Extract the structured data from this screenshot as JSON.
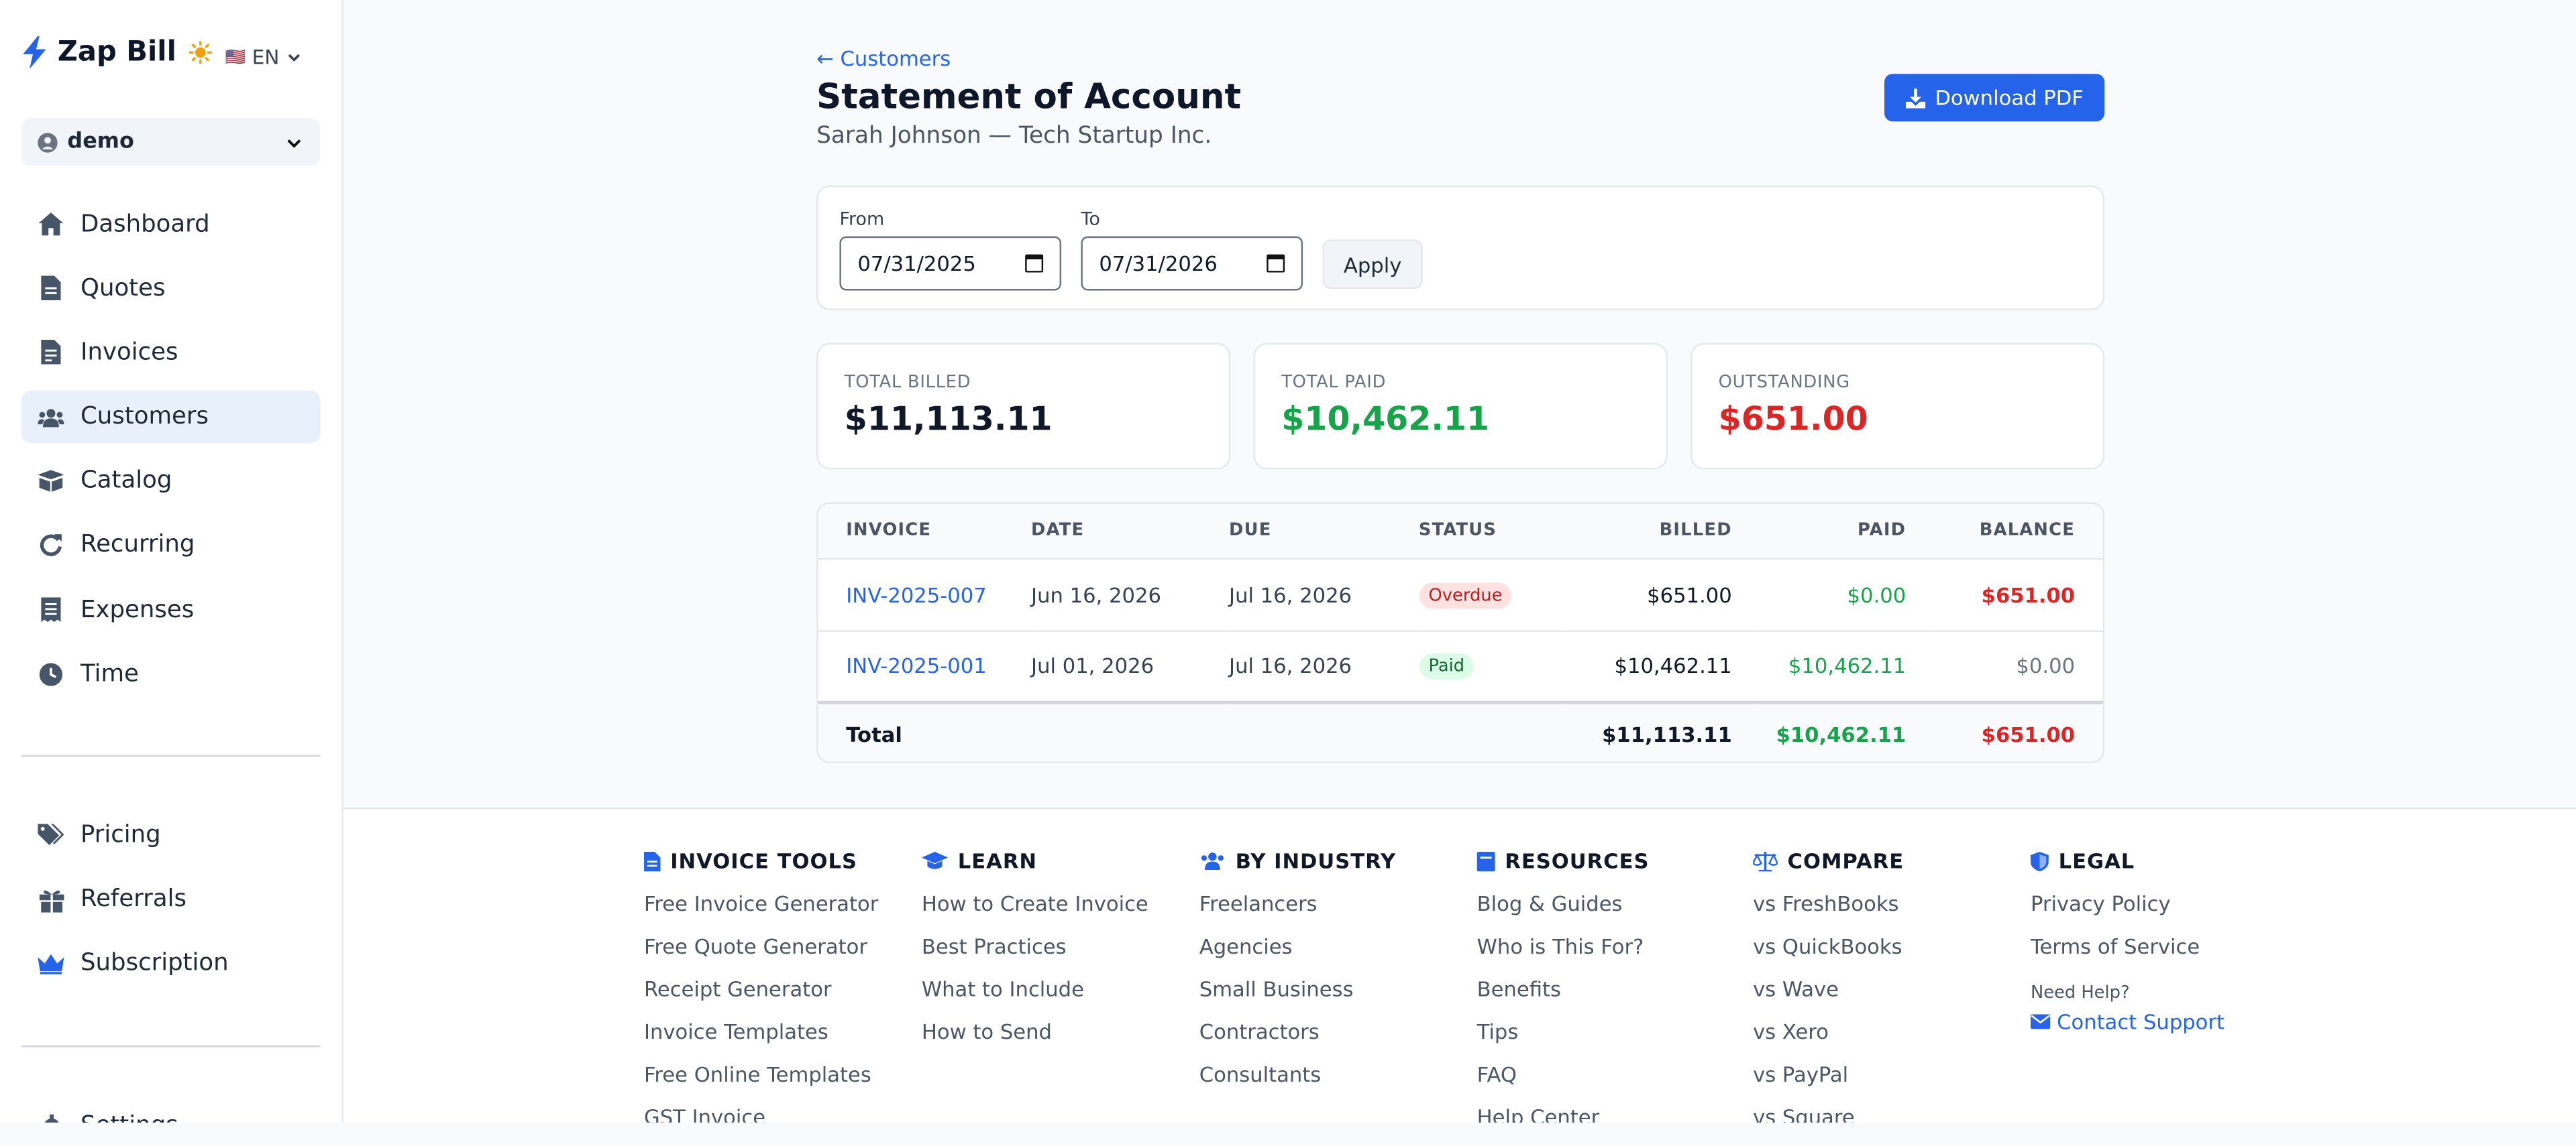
{
  "brand": {
    "name": "Zap Bill",
    "lang": "EN",
    "lang_flag": "🇺🇸"
  },
  "org": {
    "name": "demo"
  },
  "nav": [
    {
      "label": "Dashboard",
      "icon": "home-icon"
    },
    {
      "label": "Quotes",
      "icon": "document-icon"
    },
    {
      "label": "Invoices",
      "icon": "invoice-icon"
    },
    {
      "label": "Customers",
      "icon": "users-icon",
      "active": true
    },
    {
      "label": "Catalog",
      "icon": "box-icon"
    },
    {
      "label": "Recurring",
      "icon": "refresh-icon"
    },
    {
      "label": "Expenses",
      "icon": "receipt-icon"
    },
    {
      "label": "Time",
      "icon": "clock-icon"
    }
  ],
  "nav2": [
    {
      "label": "Pricing",
      "icon": "tags-icon"
    },
    {
      "label": "Referrals",
      "icon": "gift-icon"
    },
    {
      "label": "Subscription",
      "icon": "crown-icon"
    }
  ],
  "settings": {
    "label": "Settings"
  },
  "page": {
    "back": "← Customers",
    "title": "Statement of Account",
    "subtitle": "Sarah Johnson — Tech Startup Inc.",
    "download": "Download PDF"
  },
  "filter": {
    "from_label": "From",
    "from_value": "07/31/2025",
    "to_label": "To",
    "to_value": "07/31/2026",
    "apply": "Apply"
  },
  "stats": [
    {
      "label": "TOTAL BILLED",
      "value": "$11,113.11",
      "color": "#111827"
    },
    {
      "label": "TOTAL PAID",
      "value": "$10,462.11",
      "color": "#16a34a"
    },
    {
      "label": "OUTSTANDING",
      "value": "$651.00",
      "color": "#dc2626"
    }
  ],
  "table": {
    "headers": [
      "INVOICE",
      "DATE",
      "DUE",
      "STATUS",
      "BILLED",
      "PAID",
      "BALANCE"
    ],
    "rows": [
      {
        "invoice": "INV-2025-007",
        "date": "Jun 16, 2026",
        "due": "Jul 16, 2026",
        "status": "Overdue",
        "billed": "$651.00",
        "paid": "$0.00",
        "balance": "$651.00"
      },
      {
        "invoice": "INV-2025-001",
        "date": "Jul 01, 2026",
        "due": "Jul 16, 2026",
        "status": "Paid",
        "billed": "$10,462.11",
        "paid": "$10,462.11",
        "balance": "$0.00"
      }
    ],
    "total": {
      "label": "Total",
      "billed": "$11,113.11",
      "paid": "$10,462.11",
      "balance": "$651.00"
    }
  },
  "footer": {
    "columns": [
      {
        "title": "INVOICE TOOLS",
        "icon": "file-icon",
        "links": [
          "Free Invoice Generator",
          "Free Quote Generator",
          "Receipt Generator",
          "Invoice Templates",
          "Free Online Templates",
          "GST Invoice"
        ]
      },
      {
        "title": "LEARN",
        "icon": "graduation-cap-icon",
        "links": [
          "How to Create Invoice",
          "Best Practices",
          "What to Include",
          "How to Send"
        ]
      },
      {
        "title": "BY INDUSTRY",
        "icon": "users-icon",
        "links": [
          "Freelancers",
          "Agencies",
          "Small Business",
          "Contractors",
          "Consultants"
        ]
      },
      {
        "title": "RESOURCES",
        "icon": "book-icon",
        "links": [
          "Blog & Guides",
          "Who is This For?",
          "Benefits",
          "Tips",
          "FAQ",
          "Help Center"
        ]
      },
      {
        "title": "COMPARE",
        "icon": "scale-icon",
        "links": [
          "vs FreshBooks",
          "vs QuickBooks",
          "vs Wave",
          "vs Xero",
          "vs PayPal",
          "vs Square"
        ]
      },
      {
        "title": "LEGAL",
        "icon": "shield-icon",
        "links": [
          "Privacy Policy",
          "Terms of Service"
        ],
        "help": "Need Help?",
        "contact": "Contact Support"
      }
    ]
  }
}
